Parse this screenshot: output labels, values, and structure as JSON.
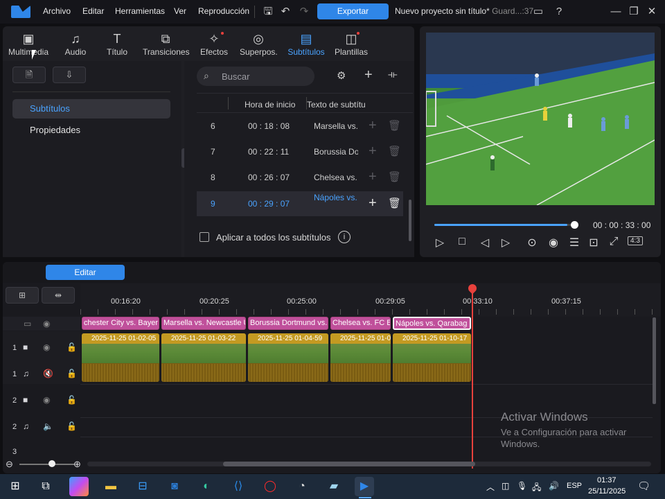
{
  "menu": [
    "Archivo",
    "Editar",
    "Herramientas",
    "Ver",
    "Reproducción"
  ],
  "export_label": "Exportar",
  "project_title": "Nuevo proyecto sin título*",
  "project_status": "Guard...:37",
  "tabs": [
    {
      "label": "Multimedia",
      "icon": "media-icon",
      "active": false
    },
    {
      "label": "Audio",
      "icon": "music-note-icon",
      "active": false
    },
    {
      "label": "Título",
      "icon": "title-icon",
      "active": false
    },
    {
      "label": "Transiciones",
      "icon": "transition-icon",
      "active": false
    },
    {
      "label": "Efectos",
      "icon": "effects-icon",
      "active": false
    },
    {
      "label": "Superpos.",
      "icon": "overlay-icon",
      "active": false
    },
    {
      "label": "Subtítulos",
      "icon": "subtitles-icon",
      "active": true
    },
    {
      "label": "Plantillas",
      "icon": "templates-icon",
      "active": false
    }
  ],
  "sidebar": {
    "items": [
      {
        "label": "Subtítulos",
        "active": true
      },
      {
        "label": "Propiedades",
        "active": false
      }
    ]
  },
  "search": {
    "placeholder": "Buscar"
  },
  "subtitle_table": {
    "headers": {
      "start": "Hora de inicio",
      "text": "Texto de subtítulo"
    },
    "rows": [
      {
        "n": "6",
        "time": "00 : 18 : 08",
        "text": "Marsella vs. Newcastle"
      },
      {
        "n": "7",
        "time": "00 : 22 : 11",
        "text": "Borussia Dortmund vs"
      },
      {
        "n": "8",
        "time": "00 : 26 : 07",
        "text": "Chelsea vs. FC Barcelona"
      },
      {
        "n": "9",
        "time": "00 : 29 : 07",
        "text": "Nápoles vs. Qarabag",
        "selected": true
      }
    ]
  },
  "apply_all": "Aplicar a todos los subtítulos",
  "preview": {
    "timecode": "00 : 00 : 33 : 00",
    "ratio": "4:3",
    "progress": 0.95
  },
  "timeline": {
    "edit_label": "Editar",
    "ticks": [
      "00:16:20",
      "00:20:25",
      "00:25:00",
      "00:29:05",
      "00:33:10",
      "00:37:15"
    ],
    "subtitle_clips": [
      "chester City vs. Bayer (",
      "Marsella vs. Newcastle U",
      "Borussia Dortmund vs.",
      "Chelsea vs. FC Ba",
      "Nápoles vs. Qarabag"
    ],
    "video_clips": [
      "2025-11-25 01-02-05",
      "2025-11-25 01-03-22",
      "2025-11-25 01-04-59",
      "2025-11-25 01-0",
      "2025-11-25 01-10-17"
    ],
    "track_numbers": [
      "1",
      "1",
      "2",
      "2",
      "3"
    ]
  },
  "watermark": {
    "title": "Activar Windows",
    "line1": "Ve a Configuración para activar",
    "line2": "Windows."
  },
  "taskbar": {
    "lang": "ESP",
    "time": "01:37",
    "date": "25/11/2025"
  }
}
